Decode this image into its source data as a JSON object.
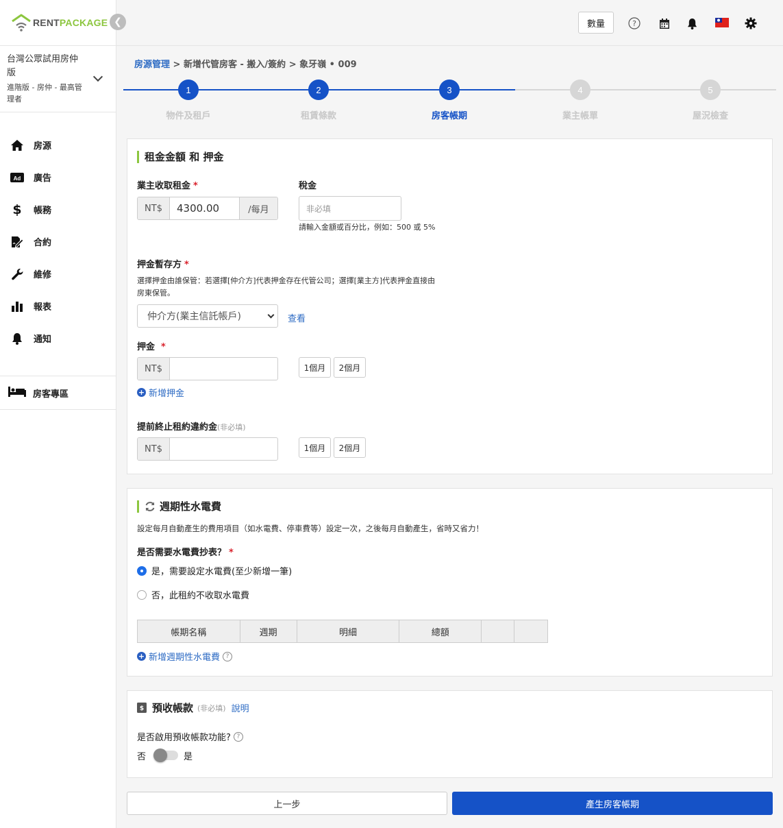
{
  "brand": {
    "rent": "RENT",
    "package": "PACKAGE"
  },
  "org": {
    "name": "台灣公眾試用房仲版",
    "plan": "進階版 - 房仲 - 最高管理者"
  },
  "nav": {
    "items": [
      {
        "label": "房源",
        "icon": "home-icon"
      },
      {
        "label": "廣告",
        "icon": "ad-icon"
      },
      {
        "label": "帳務",
        "icon": "dollar-icon"
      },
      {
        "label": "合約",
        "icon": "contract-icon"
      },
      {
        "label": "維修",
        "icon": "wrench-icon"
      },
      {
        "label": "報表",
        "icon": "bar-chart-icon"
      },
      {
        "label": "通知",
        "icon": "bell-icon"
      }
    ],
    "tenant_area": "房客專區"
  },
  "topbar": {
    "quantity_label": "數量"
  },
  "breadcrumb": {
    "root": "房源管理",
    "separator": ">",
    "step": "新增代管房客 - 搬入/簽約",
    "property": "象牙嶺 • 009"
  },
  "stepper": {
    "steps": [
      {
        "num": "1",
        "label": "物件及租戶"
      },
      {
        "num": "2",
        "label": "租賃條款"
      },
      {
        "num": "3",
        "label": "房客帳期"
      },
      {
        "num": "4",
        "label": "業主帳單"
      },
      {
        "num": "5",
        "label": "屋況檢查"
      }
    ],
    "current": 3,
    "colors": {
      "active": "#1552c7",
      "inactive": "#d6d6d6",
      "active_label": "#1552c7",
      "inactive_label": "#c8c8c8"
    }
  },
  "rent_card": {
    "title": "租金金額 和 押金",
    "rent_label": "業主收取租金",
    "currency": "NT$",
    "rent_value": "4300.00",
    "per_month": "/每月",
    "tax_label": "稅金",
    "tax_placeholder": "非必填",
    "tax_help": "請輸入金額或百分比，例如：500 或 5%",
    "holder_label": "押金暫存方",
    "holder_help": "選擇押金由誰保管：若選擇[仲介方]代表押金存在代管公司；選擇[業主方]代表押金直接由房東保管。",
    "holder_value": "仲介方(業主信託帳戶)",
    "view_link": "查看",
    "deposit_label": "押金",
    "one_month": "1個月",
    "two_month": "2個月",
    "add_deposit": "新增押金",
    "penalty_label": "提前終止租約違約金",
    "penalty_optional": "(非必填)"
  },
  "utility_card": {
    "title": "週期性水電費",
    "desc": "設定每月自動產生的費用項目（如水電費、停車費等）設定一次，之後每月自動產生，省時又省力！",
    "question": "是否需要水電費抄表？",
    "option_yes": "是，需要設定水電費(至少新增一筆)",
    "option_no": "否，此租約不收取水電費",
    "table_headers": [
      "帳期名稱",
      "週期",
      "明細",
      "總額",
      "",
      ""
    ],
    "add_link": "新增週期性水電費"
  },
  "prepay_card": {
    "title": "預收帳款",
    "optional": "(非必填)",
    "explain_link": "說明",
    "question": "是否啟用預收帳款功能?",
    "no": "否",
    "yes": "是",
    "enabled": false
  },
  "footer": {
    "prev": "上一步",
    "next": "產生房客帳期"
  }
}
